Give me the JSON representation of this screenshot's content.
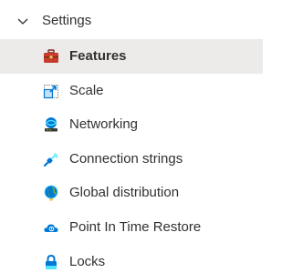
{
  "group": {
    "label": "Settings",
    "expanded": true,
    "icon": "chevron-down-icon"
  },
  "items": [
    {
      "label": "Features",
      "icon": "toolbox-icon",
      "selected": true
    },
    {
      "label": "Scale",
      "icon": "scale-icon",
      "selected": false
    },
    {
      "label": "Networking",
      "icon": "networking-icon",
      "selected": false
    },
    {
      "label": "Connection strings",
      "icon": "plug-icon",
      "selected": false
    },
    {
      "label": "Global distribution",
      "icon": "globe-icon",
      "selected": false
    },
    {
      "label": "Point In Time Restore",
      "icon": "cloud-restore-icon",
      "selected": false
    },
    {
      "label": "Locks",
      "icon": "lock-icon",
      "selected": false
    }
  ],
  "colors": {
    "selected_background": "#edebe9",
    "text": "#323130",
    "azure_blue": "#0078d4",
    "toolbox_red": "#c53c2c"
  }
}
